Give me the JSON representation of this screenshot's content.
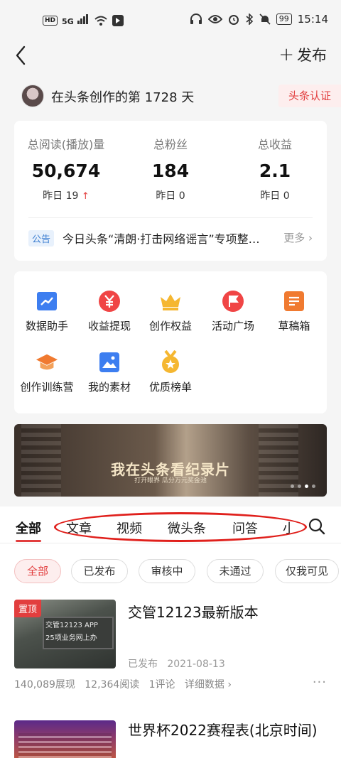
{
  "status_bar": {
    "left_chip": "HD",
    "signal_label": "5G",
    "time": "15:14",
    "battery": "99"
  },
  "nav": {
    "back_icon": "chevron-left-icon",
    "publish_label": "发布"
  },
  "creator": {
    "days_text": "在头条创作的第 1728 天",
    "cert_label": "头条认证"
  },
  "stats": [
    {
      "label": "总阅读(播放)量",
      "value": "50,674",
      "delta_label": "昨日",
      "delta_value": "19",
      "trend": "up"
    },
    {
      "label": "总粉丝",
      "value": "184",
      "delta_label": "昨日",
      "delta_value": "0",
      "trend": ""
    },
    {
      "label": "总收益",
      "value": "2.1",
      "delta_label": "昨日",
      "delta_value": "0",
      "trend": ""
    }
  ],
  "notice": {
    "tag": "公告",
    "text": "今日头条“清朗·打击网络谣言”专项整…",
    "more": "更多"
  },
  "tools": [
    {
      "label": "数据助手",
      "icon": "chart-icon",
      "color": "#3d7ef0"
    },
    {
      "label": "收益提现",
      "icon": "yen-icon",
      "color": "#f04545"
    },
    {
      "label": "创作权益",
      "icon": "crown-icon",
      "color": "#f5b731"
    },
    {
      "label": "活动广场",
      "icon": "flag-icon",
      "color": "#f04545"
    },
    {
      "label": "草稿箱",
      "icon": "draft-icon",
      "color": "#f07a30"
    },
    {
      "label": "创作训练营",
      "icon": "graduation-cap-icon",
      "color": "#f07a30"
    },
    {
      "label": "我的素材",
      "icon": "image-icon",
      "color": "#3d7ef0"
    },
    {
      "label": "优质榜单",
      "icon": "medal-icon",
      "color": "#f5b731"
    }
  ],
  "banner": {
    "title": "我在头条看纪录片",
    "subtitle": "打开眼界  瓜分万元奖金池"
  },
  "tabs": [
    "全部",
    "文章",
    "视频",
    "微头条",
    "问答",
    "小"
  ],
  "filters": [
    "全部",
    "已发布",
    "审核中",
    "未通过",
    "仅我可见"
  ],
  "articles": [
    {
      "title": "交管12123最新版本",
      "pin": "置顶",
      "thumb_text_1": "交管12123 APP",
      "thumb_text_2": "25项业务网上办",
      "status": "已发布",
      "date": "2021-08-13",
      "views": "140,089展现",
      "reads": "12,364阅读",
      "comments": "1评论",
      "detail": "详细数据",
      "more": "···"
    },
    {
      "title": "世界杯2022赛程表(北京时间)"
    }
  ],
  "colors": {
    "accent": "#e23e3e",
    "link": "#3c7ed0"
  }
}
